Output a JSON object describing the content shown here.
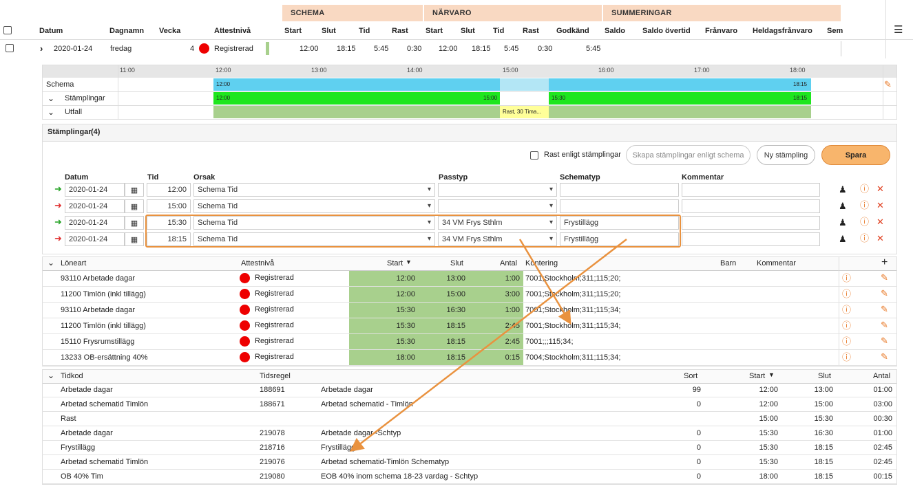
{
  "groups": {
    "schema": "SCHEMA",
    "narvaro": "NÄRVARO",
    "summeringar": "SUMMERINGAR"
  },
  "columns": {
    "datum": "Datum",
    "dagnamn": "Dagnamn",
    "vecka": "Vecka",
    "attestniva": "Attestnivå",
    "s_start": "Start",
    "s_slut": "Slut",
    "s_tid": "Tid",
    "s_rast": "Rast",
    "n_start": "Start",
    "n_slut": "Slut",
    "n_tid": "Tid",
    "n_rast": "Rast",
    "godkand": "Godkänd",
    "saldo": "Saldo",
    "saldo_overtid": "Saldo övertid",
    "franvaro": "Frånvaro",
    "heldag": "Heldagsfrånvaro",
    "sem": "Sem"
  },
  "day": {
    "date": "2020-01-24",
    "dagnamn": "fredag",
    "vecka": "4",
    "attest": "Registrerad",
    "s_start": "12:00",
    "s_slut": "18:15",
    "s_tid": "5:45",
    "s_rast": "0:30",
    "n_start": "12:00",
    "n_slut": "18:15",
    "n_tid": "5:45",
    "n_rast": "0:30",
    "godkand": "5:45"
  },
  "timeline": {
    "hours": [
      "11:00",
      "12:00",
      "13:00",
      "14:00",
      "15:00",
      "16:00",
      "17:00",
      "18:00"
    ],
    "rows": {
      "schema": "Schema",
      "stamplingar": "Stämplingar",
      "utfall": "Utfall"
    },
    "schema_start": "12:00",
    "schema_end": "18:15",
    "st1_start": "12:00",
    "st1_end": "15:00",
    "st2_start": "15:30",
    "st2_end": "18:15",
    "rast": "Rast, 30 Tima..."
  },
  "stamp": {
    "title": "Stämplingar",
    "count": "(4)",
    "rast_label": "Rast enligt stämplingar",
    "skapa": "Skapa stämplingar enligt schema",
    "ny": "Ny stämpling",
    "spara": "Spara",
    "headers": {
      "datum": "Datum",
      "tid": "Tid",
      "orsak": "Orsak",
      "passtyp": "Passtyp",
      "schematyp": "Schematyp",
      "kommentar": "Kommentar"
    },
    "rows": [
      {
        "date": "2020-01-24",
        "tid": "12:00",
        "orsak": "Schema Tid",
        "passtyp": "",
        "schematyp": ""
      },
      {
        "date": "2020-01-24",
        "tid": "15:00",
        "orsak": "Schema Tid",
        "passtyp": "",
        "schematyp": ""
      },
      {
        "date": "2020-01-24",
        "tid": "15:30",
        "orsak": "Schema Tid",
        "passtyp": "34 VM Frys Sthlm",
        "schematyp": "Frystillägg"
      },
      {
        "date": "2020-01-24",
        "tid": "18:15",
        "orsak": "Schema Tid",
        "passtyp": "34 VM Frys Sthlm",
        "schematyp": "Frystillägg"
      }
    ]
  },
  "loneart": {
    "headers": {
      "loneart": "Löneart",
      "attest": "Attestnivå",
      "start": "Start",
      "slut": "Slut",
      "antal": "Antal",
      "kontering": "Kontering",
      "barn": "Barn",
      "kommentar": "Kommentar"
    },
    "rows": [
      {
        "name": "93110 Arbetade dagar",
        "attest": "Registrerad",
        "start": "12:00",
        "slut": "13:00",
        "antal": "1:00",
        "kontering": "7001;Stockholm;311;115;20;"
      },
      {
        "name": "11200 Timlön (inkl tillägg)",
        "attest": "Registrerad",
        "start": "12:00",
        "slut": "15:00",
        "antal": "3:00",
        "kontering": "7001;Stockholm;311;115;20;"
      },
      {
        "name": "93110 Arbetade dagar",
        "attest": "Registrerad",
        "start": "15:30",
        "slut": "16:30",
        "antal": "1:00",
        "kontering": "7001;Stockholm;311;115;34;"
      },
      {
        "name": "11200 Timlön (inkl tillägg)",
        "attest": "Registrerad",
        "start": "15:30",
        "slut": "18:15",
        "antal": "2:45",
        "kontering": "7001;Stockholm;311;115;34;"
      },
      {
        "name": "15110 Frysrumstillägg",
        "attest": "Registrerad",
        "start": "15:30",
        "slut": "18:15",
        "antal": "2:45",
        "kontering": "7001;;;115;34;"
      },
      {
        "name": "13233 OB-ersättning 40%",
        "attest": "Registrerad",
        "start": "18:00",
        "slut": "18:15",
        "antal": "0:15",
        "kontering": "7004;Stockholm;311;115;34;"
      }
    ]
  },
  "tidkod": {
    "headers": {
      "tidkod": "Tidkod",
      "tidsregel": "Tidsregel",
      "sort": "Sort",
      "start": "Start",
      "slut": "Slut",
      "antal": "Antal"
    },
    "rows": [
      {
        "kod": "Arbetade dagar",
        "regel": "188691",
        "regelnamn": "Arbetade dagar",
        "sort": "99",
        "start": "12:00",
        "slut": "13:00",
        "antal": "01:00"
      },
      {
        "kod": "Arbetad schematid Timlön",
        "regel": "188671",
        "regelnamn": "Arbetad schematid - Timlön",
        "sort": "0",
        "start": "12:00",
        "slut": "15:00",
        "antal": "03:00"
      },
      {
        "kod": "Rast",
        "regel": "",
        "regelnamn": "",
        "sort": "",
        "start": "15:00",
        "slut": "15:30",
        "antal": "00:30"
      },
      {
        "kod": "Arbetade dagar",
        "regel": "219078",
        "regelnamn": "Arbetade dagar -Schtyp",
        "sort": "0",
        "start": "15:30",
        "slut": "16:30",
        "antal": "01:00"
      },
      {
        "kod": "Frystillägg",
        "regel": "218716",
        "regelnamn": "Frystillägg",
        "sort": "0",
        "start": "15:30",
        "slut": "18:15",
        "antal": "02:45"
      },
      {
        "kod": "Arbetad schematid Timlön",
        "regel": "219076",
        "regelnamn": "Arbetad schematid-Timlön Schematyp",
        "sort": "0",
        "start": "15:30",
        "slut": "18:15",
        "antal": "02:45"
      },
      {
        "kod": "OB 40% Tim",
        "regel": "219080",
        "regelnamn": "EOB 40% inom schema 18-23 vardag - Schtyp",
        "sort": "0",
        "start": "18:00",
        "slut": "18:15",
        "antal": "00:15"
      }
    ]
  },
  "colors": {
    "accent": "#e97b2a",
    "group": "#f9d9c2",
    "schema_bar": "#5fd0f0",
    "stamp_bar": "#1ee61e",
    "utfall_bar": "#a8d08d",
    "rast": "#ffff99",
    "status": "#ee0000"
  }
}
